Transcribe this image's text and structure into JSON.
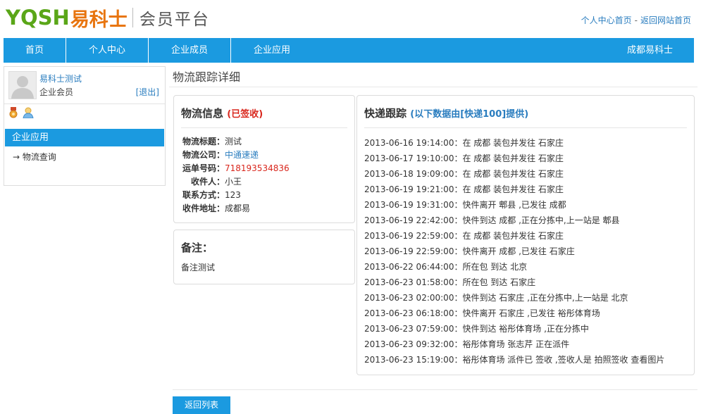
{
  "header": {
    "logo_en": "YQSH",
    "logo_cn": "易科士",
    "platform_title": "会员平台",
    "links": [
      {
        "label": "个人中心首页"
      },
      {
        "label": "返回网站首页"
      }
    ],
    "link_separator": "-"
  },
  "nav": {
    "items": [
      {
        "label": "首页"
      },
      {
        "label": "个人中心"
      },
      {
        "label": "企业成员"
      },
      {
        "label": "企业应用"
      }
    ],
    "right_label": "成都易科士"
  },
  "sidebar": {
    "username": "易科士测试",
    "user_type": "企业会员",
    "logout_label": "[退出]",
    "section_title": "企业应用",
    "menu_item": "→ 物流查询"
  },
  "main": {
    "page_title": "物流跟踪详细",
    "logistics": {
      "title": "物流信息",
      "status": "(已签收)",
      "rows": [
        {
          "label": "物流标题：",
          "value": "测试"
        },
        {
          "label": "物流公司：",
          "value": "中通速递"
        },
        {
          "label": "运单号码：",
          "value": "718193534836"
        },
        {
          "label": "收件人：",
          "value": "小王"
        },
        {
          "label": "联系方式：",
          "value": "123"
        },
        {
          "label": "收件地址：",
          "value": "成都易"
        }
      ]
    },
    "remark": {
      "title": "备注：",
      "content": "备注测试"
    },
    "tracking": {
      "title": "快递跟踪",
      "source_note": "(以下数据由[快递100]提供)",
      "rows": [
        "2013-06-16 19:14:00：在 成都 装包并发往 石家庄",
        "2013-06-17 19:10:00：在 成都 装包并发往 石家庄",
        "2013-06-18 19:09:00：在 成都 装包并发往 石家庄",
        "2013-06-19 19:21:00：在 成都 装包并发往 石家庄",
        "2013-06-19 19:31:00：快件离开 郫县 ,已发往 成都",
        "2013-06-19 22:42:00：快件到达 成都 ,正在分拣中,上一站是 郫县",
        "2013-06-19 22:59:00：在 成都 装包并发往 石家庄",
        "2013-06-19 22:59:00：快件离开 成都 ,已发往 石家庄",
        "2013-06-22 06:44:00：所在包 到达 北京",
        "2013-06-23 01:58:00：所在包 到达 石家庄",
        "2013-06-23 02:00:00：快件到达 石家庄 ,正在分拣中,上一站是 北京",
        "2013-06-23 06:18:00：快件离开 石家庄 ,已发往 裕彤体育场",
        "2013-06-23 07:59:00：快件到达 裕彤体育场 ,正在分拣中",
        "2013-06-23 09:32:00：裕彤体育场 张志芹 正在派件",
        "2013-06-23 15:19:00：裕彤体育场 派件已 签收 ,签收人是 拍照签收 查看图片"
      ]
    },
    "back_button": "返回列表"
  },
  "colors": {
    "primary_blue": "#1b9ae0",
    "link_blue": "#2a7dbf",
    "logo_green": "#5aa618",
    "logo_orange": "#e8750f",
    "status_red": "#d9261c"
  },
  "icons": [
    "user-avatar-icon",
    "medal-icon",
    "person-icon"
  ]
}
